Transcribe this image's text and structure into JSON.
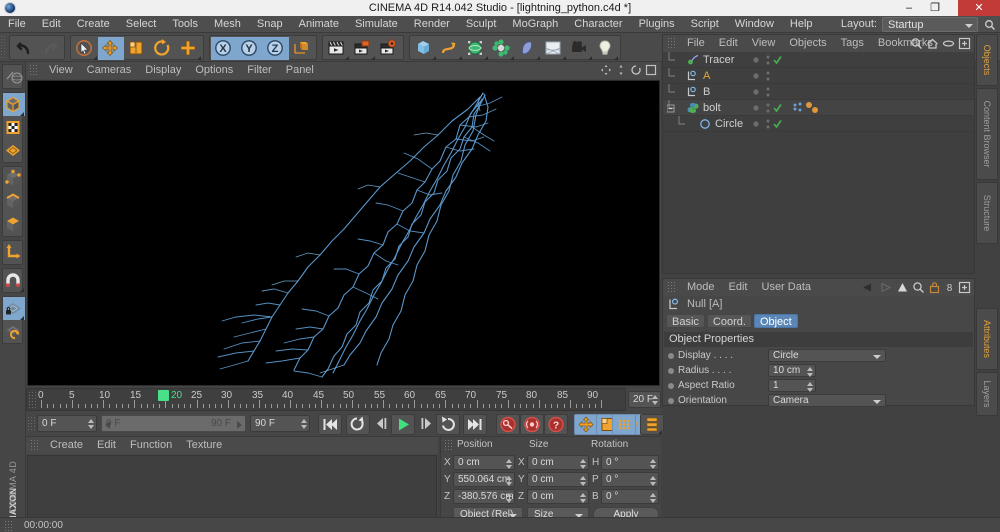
{
  "window": {
    "title": "CINEMA 4D R14.042 Studio - [lightning_python.c4d *]",
    "minimize": "–",
    "maximize": "❐",
    "close": "✕",
    "logo_icon": "c4d-logo-icon"
  },
  "menubar": {
    "items": [
      "File",
      "Edit",
      "Create",
      "Select",
      "Tools",
      "Mesh",
      "Snap",
      "Animate",
      "Simulate",
      "Render",
      "Sculpt",
      "MoGraph",
      "Character",
      "Plugins",
      "Script",
      "Window",
      "Help"
    ],
    "layout_label": "Layout:",
    "layout_value": "Startup",
    "search_icon": "magnifier-icon"
  },
  "toolbar": {
    "groups": [
      {
        "name": "undo-redo",
        "buttons": [
          {
            "name": "undo-button",
            "icon": "undo-arrow-icon",
            "active": false
          },
          {
            "name": "redo-button",
            "icon": "redo-arrow-icon",
            "active": false
          }
        ]
      },
      {
        "name": "transform-tools",
        "buttons": [
          {
            "name": "live-selection-tool",
            "icon": "cursor-circle-icon",
            "active": false
          },
          {
            "name": "move-tool",
            "icon": "move-cross-icon",
            "active": true
          },
          {
            "name": "scale-tool",
            "icon": "scale-box-icon",
            "active": false
          },
          {
            "name": "rotate-tool",
            "icon": "rotate-circle-icon",
            "active": false
          },
          {
            "name": "position-tool",
            "icon": "plus-cross-icon",
            "active": false
          }
        ]
      },
      {
        "name": "axis-locks",
        "buttons": [
          {
            "name": "x-axis-lock",
            "icon": "x-axis-icon",
            "active": true
          },
          {
            "name": "y-axis-lock",
            "icon": "y-axis-icon",
            "active": true
          },
          {
            "name": "z-axis-lock",
            "icon": "z-axis-icon",
            "active": true
          },
          {
            "name": "world-object-axis",
            "icon": "axis-cube-icon",
            "active": false
          }
        ]
      },
      {
        "name": "render-tools",
        "buttons": [
          {
            "name": "render-view-button",
            "icon": "clapper-icon",
            "active": false
          },
          {
            "name": "render-region-button",
            "icon": "clapper-region-icon",
            "active": false
          },
          {
            "name": "render-settings-button",
            "icon": "clapper-gear-icon",
            "active": false
          }
        ]
      },
      {
        "name": "create-objects",
        "buttons": [
          {
            "name": "add-cube-button",
            "icon": "cube-icon",
            "active": false
          },
          {
            "name": "add-spline-button",
            "icon": "spline-icon",
            "active": false
          },
          {
            "name": "add-nurbs-button",
            "icon": "nurbs-sphere-icon",
            "active": false
          },
          {
            "name": "add-array-button",
            "icon": "array-icon",
            "active": false
          },
          {
            "name": "add-deformer-button",
            "icon": "bend-deformer-icon",
            "active": false
          },
          {
            "name": "add-environment-button",
            "icon": "floor-environment-icon",
            "active": false
          },
          {
            "name": "add-camera-button",
            "icon": "camera-icon",
            "active": false
          },
          {
            "name": "add-light-button",
            "icon": "lightbulb-icon",
            "active": false
          }
        ]
      }
    ]
  },
  "left_toolbar": {
    "groups": [
      {
        "name": "group-selection",
        "buttons": [
          {
            "name": "selection-modes-button",
            "icon": "selection-globe-icon",
            "active": false
          }
        ]
      },
      {
        "name": "group-modes",
        "buttons": [
          {
            "name": "make-editable-button",
            "icon": "cube-editable-icon",
            "active": true
          },
          {
            "name": "model-mode-button",
            "icon": "checker-model-icon",
            "active": false
          },
          {
            "name": "texture-mode-button",
            "icon": "texture-grid-icon",
            "active": false
          }
        ]
      },
      {
        "name": "group-components",
        "buttons": [
          {
            "name": "points-mode-button",
            "icon": "points-cube-icon",
            "active": false
          },
          {
            "name": "edges-mode-button",
            "icon": "edges-cube-icon",
            "active": false
          },
          {
            "name": "polygons-mode-button",
            "icon": "polygons-cube-icon",
            "active": false
          }
        ]
      },
      {
        "name": "group-axis",
        "buttons": [
          {
            "name": "enable-axis-button",
            "icon": "axis-l-icon",
            "active": false
          }
        ]
      },
      {
        "name": "group-snap",
        "buttons": [
          {
            "name": "magnet-tool-button",
            "icon": "magnet-icon",
            "active": false
          }
        ]
      },
      {
        "name": "group-workplane",
        "buttons": [
          {
            "name": "lock-workplane-button",
            "icon": "workplane-lock-icon",
            "active": true
          },
          {
            "name": "align-workplane-button",
            "icon": "workplane-rotate-icon",
            "active": false
          }
        ]
      }
    ]
  },
  "viewport": {
    "menu_items": [
      "View",
      "Cameras",
      "Display",
      "Options",
      "Filter",
      "Panel"
    ],
    "nav_icons": [
      "pan-icon",
      "zoom-icon",
      "rotate-icon",
      "maximize-view-icon"
    ],
    "background_color": "#000000",
    "spline_color": "#5f9fd6",
    "object_label": "lightning bolt spline"
  },
  "timeline": {
    "ticks": [
      {
        "label": "0",
        "frame": 0
      },
      {
        "label": "5",
        "frame": 5
      },
      {
        "label": "10",
        "frame": 10
      },
      {
        "label": "15",
        "frame": 15
      },
      {
        "label": "20",
        "frame": 20
      },
      {
        "label": "25",
        "frame": 25
      },
      {
        "label": "30",
        "frame": 30
      },
      {
        "label": "35",
        "frame": 35
      },
      {
        "label": "40",
        "frame": 40
      },
      {
        "label": "45",
        "frame": 45
      },
      {
        "label": "50",
        "frame": 50
      },
      {
        "label": "55",
        "frame": 55
      },
      {
        "label": "60",
        "frame": 60
      },
      {
        "label": "65",
        "frame": 65
      },
      {
        "label": "70",
        "frame": 70
      },
      {
        "label": "75",
        "frame": 75
      },
      {
        "label": "80",
        "frame": 80
      },
      {
        "label": "85",
        "frame": 85
      },
      {
        "label": "90",
        "frame": 90
      }
    ],
    "playhead_frame": 20,
    "playhead_label": "20",
    "playhead_color": "#49e08a",
    "fps_value": "20 F",
    "current_frame": "0 F",
    "range_start": "0 F",
    "range_end": "90 F",
    "end_frame": "90 F",
    "buttons": [
      {
        "name": "go-to-start-button",
        "icon": "skip-back-icon"
      },
      {
        "name": "loop-button",
        "icon": "loop-icon"
      },
      {
        "name": "previous-frame-button",
        "icon": "step-back-icon"
      },
      {
        "name": "play-button",
        "icon": "play-icon"
      },
      {
        "name": "next-frame-button",
        "icon": "step-forward-icon"
      },
      {
        "name": "play-reverse-button",
        "icon": "play-reverse-icon"
      },
      {
        "name": "go-to-end-button",
        "icon": "skip-forward-icon"
      },
      {
        "name": "record-active-objects-button",
        "icon": "record-key-icon"
      },
      {
        "name": "autokeying-button",
        "icon": "autokey-icon"
      },
      {
        "name": "keyframe-selection-button",
        "icon": "question-key-icon"
      },
      {
        "name": "position-key-button",
        "icon": "move-key-icon"
      },
      {
        "name": "scale-key-button",
        "icon": "scale-key-icon"
      },
      {
        "name": "rotation-key-button",
        "icon": "rotate-key-icon"
      },
      {
        "name": "parameter-key-button",
        "icon": "param-key-icon"
      },
      {
        "name": "point-level-animation-button",
        "icon": "pla-dots-icon"
      },
      {
        "name": "timeline-view-button",
        "icon": "timeline-stack-icon"
      }
    ]
  },
  "material_manager": {
    "menu_items": [
      "Create",
      "Edit",
      "Function",
      "Texture"
    ],
    "materials": []
  },
  "coordinates": {
    "headers": [
      "Position",
      "Size",
      "Rotation"
    ],
    "rows": [
      {
        "pos_label": "X",
        "pos_value": "0 cm",
        "size_label": "X",
        "size_value": "0 cm",
        "rot_label": "H",
        "rot_value": "0 °"
      },
      {
        "pos_label": "Y",
        "pos_value": "550.064 cm",
        "size_label": "Y",
        "size_value": "0 cm",
        "rot_label": "P",
        "rot_value": "0 °"
      },
      {
        "pos_label": "Z",
        "pos_value": "-380.576 cm",
        "size_label": "Z",
        "size_value": "0 cm",
        "rot_label": "B",
        "rot_value": "0 °"
      }
    ],
    "mode_value": "Object (Rel)",
    "size_mode_value": "Size",
    "apply_label": "Apply"
  },
  "object_manager": {
    "menu_items": [
      "File",
      "Edit",
      "View",
      "Objects",
      "Tags",
      "Bookmarks"
    ],
    "icons": [
      "search-icon",
      "home-icon",
      "eye-icon",
      "new-window-icon"
    ],
    "rows": [
      {
        "name": "Tracer",
        "icon": "tracer-icon",
        "indent": 14,
        "color": "#cfcfcf",
        "visible_dot": true,
        "check": true,
        "tags": []
      },
      {
        "name": "A",
        "icon": "null-object-icon",
        "indent": 14,
        "color": "#e0a83c",
        "visible_dot": true,
        "check": false,
        "tags": []
      },
      {
        "name": "B",
        "icon": "null-object-icon",
        "indent": 14,
        "color": "#cfcfcf",
        "visible_dot": true,
        "check": false,
        "tags": []
      },
      {
        "name": "bolt",
        "icon": "python-icon",
        "indent": 14,
        "color": "#cfcfcf",
        "visible_dot": true,
        "check": true,
        "tags": [
          "python-tag-icon",
          "sphere-tag-icon",
          "sphere-tag-icon"
        ]
      },
      {
        "name": "Circle",
        "icon": "circle-spline-icon",
        "indent": 26,
        "color": "#cfcfcf",
        "visible_dot": true,
        "check": true,
        "tags": []
      }
    ]
  },
  "attributes_manager": {
    "menu_items": [
      "Mode",
      "Edit",
      "User Data"
    ],
    "icons": [
      "back-arrow-icon",
      "forward-arrow-icon",
      "up-arrow-icon",
      "search-icon",
      "lock-icon",
      "eight-icon",
      "new-window-icon"
    ],
    "object_icon": "null-object-icon",
    "object_name": "Null [A]",
    "tabs": [
      {
        "label": "Basic",
        "active": false
      },
      {
        "label": "Coord.",
        "active": false
      },
      {
        "label": "Object",
        "active": true
      }
    ],
    "section_title": "Object Properties",
    "properties": [
      {
        "label": "Display . . . .",
        "value": "Circle",
        "type": "dropdown"
      },
      {
        "label": "Radius . . . .",
        "value": "10 cm",
        "type": "number"
      },
      {
        "label": "Aspect Ratio",
        "value": "1",
        "type": "number"
      },
      {
        "label": "Orientation",
        "value": "Camera",
        "type": "dropdown"
      }
    ]
  },
  "vertical_tabs": {
    "top": [
      {
        "label": "Objects",
        "active": true
      },
      {
        "label": "Content Browser",
        "active": false
      },
      {
        "label": "Structure",
        "active": false
      }
    ],
    "bottom": [
      {
        "label": "Attributes",
        "active": true
      },
      {
        "label": "Layers",
        "active": false
      }
    ]
  },
  "branding": {
    "maxon": "MAXON",
    "cinema4d": "CINEMA 4D"
  },
  "status": {
    "time": "00:00:00"
  }
}
